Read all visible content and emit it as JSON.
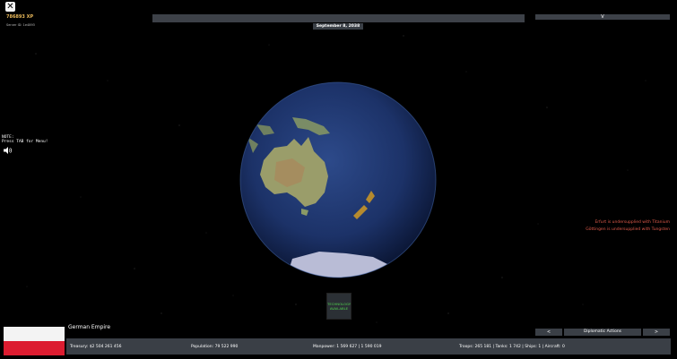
{
  "top_left": {
    "close_glyph": "✕",
    "xp": "786893 XP",
    "server_id": "Server ID: 1e4893"
  },
  "header": {
    "date": "September 8, 2038",
    "right_toggle": "V"
  },
  "note": {
    "line1": "NOTE:",
    "line2": "Press TAB for Menu!"
  },
  "alerts": [
    "Erfurt is undersupplied with Titanium",
    "Göttingen is undersupplied with Tungsten"
  ],
  "technology_button": {
    "line1": "TECHNOLOGY",
    "line2": "AVAILABLE"
  },
  "country": {
    "name": "German Empire",
    "flag_colors": [
      "#f3f3f3",
      "#dc1c30"
    ]
  },
  "stats": {
    "treasury": "Treasury: $2 504 261 456",
    "population": "Population: 79 522 990",
    "manpower": "Manpower: 1 569 627 | 1 590 019",
    "troops": "Troops: 265 181 | Tanks: 1 742 | Ships: 1 | Aircraft: 0"
  },
  "nav": {
    "prev": "<",
    "diplomatic": "Diplomatic Actions",
    "next": ">"
  },
  "icons": {
    "speaker": "speaker-icon",
    "close": "close-icon"
  }
}
